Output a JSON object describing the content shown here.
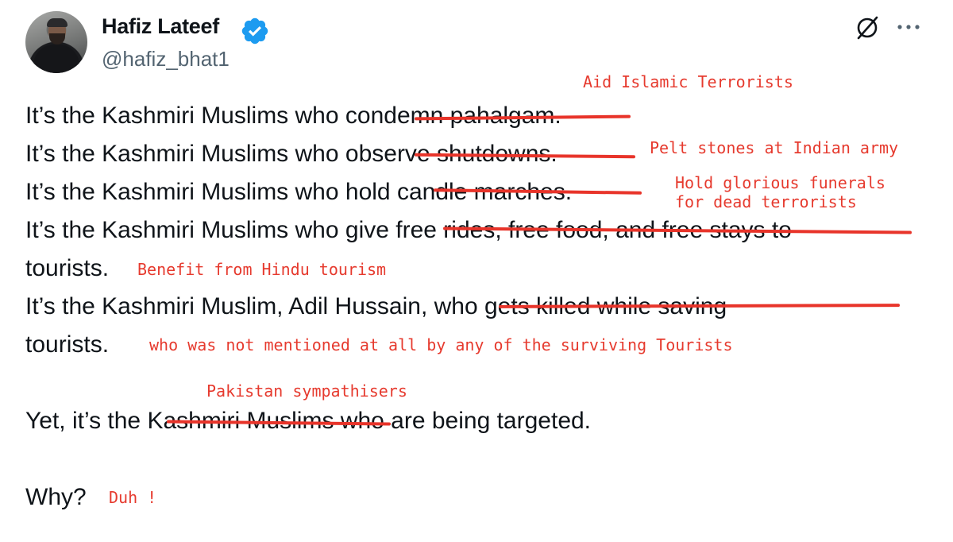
{
  "author": {
    "name": "Hafiz Lateef",
    "handle": "@hafiz_bhat1",
    "verified": true,
    "verified_color": "#1d9bf0"
  },
  "actions": {
    "grok_icon": "grok-icon",
    "more_icon": "more-options-icon"
  },
  "tweet": {
    "lines": [
      "It’s the Kashmiri Muslims who condemn pahalgam.",
      "It’s the Kashmiri Muslims who observe shutdowns.",
      "It’s the Kashmiri Muslims who hold candle marches.",
      "It’s the Kashmiri Muslims who give free rides, free food, and free stays to",
      "tourists.",
      "It’s the Kashmiri Muslim, Adil Hussain, who gets killed while saving",
      "tourists.",
      "Yet, it’s the Kashmiri Muslims who are being targeted.",
      "Why?"
    ]
  },
  "annotations": {
    "color": "#e63a2e",
    "items": [
      "Aid Islamic Terrorists",
      "Pelt stones at Indian army",
      "Hold glorious funerals",
      "for dead terrorists",
      "Benefit from Hindu tourism",
      "who was not mentioned at all by any of the surviving Tourists",
      "Pakistan sympathisers",
      "Duh !"
    ]
  }
}
